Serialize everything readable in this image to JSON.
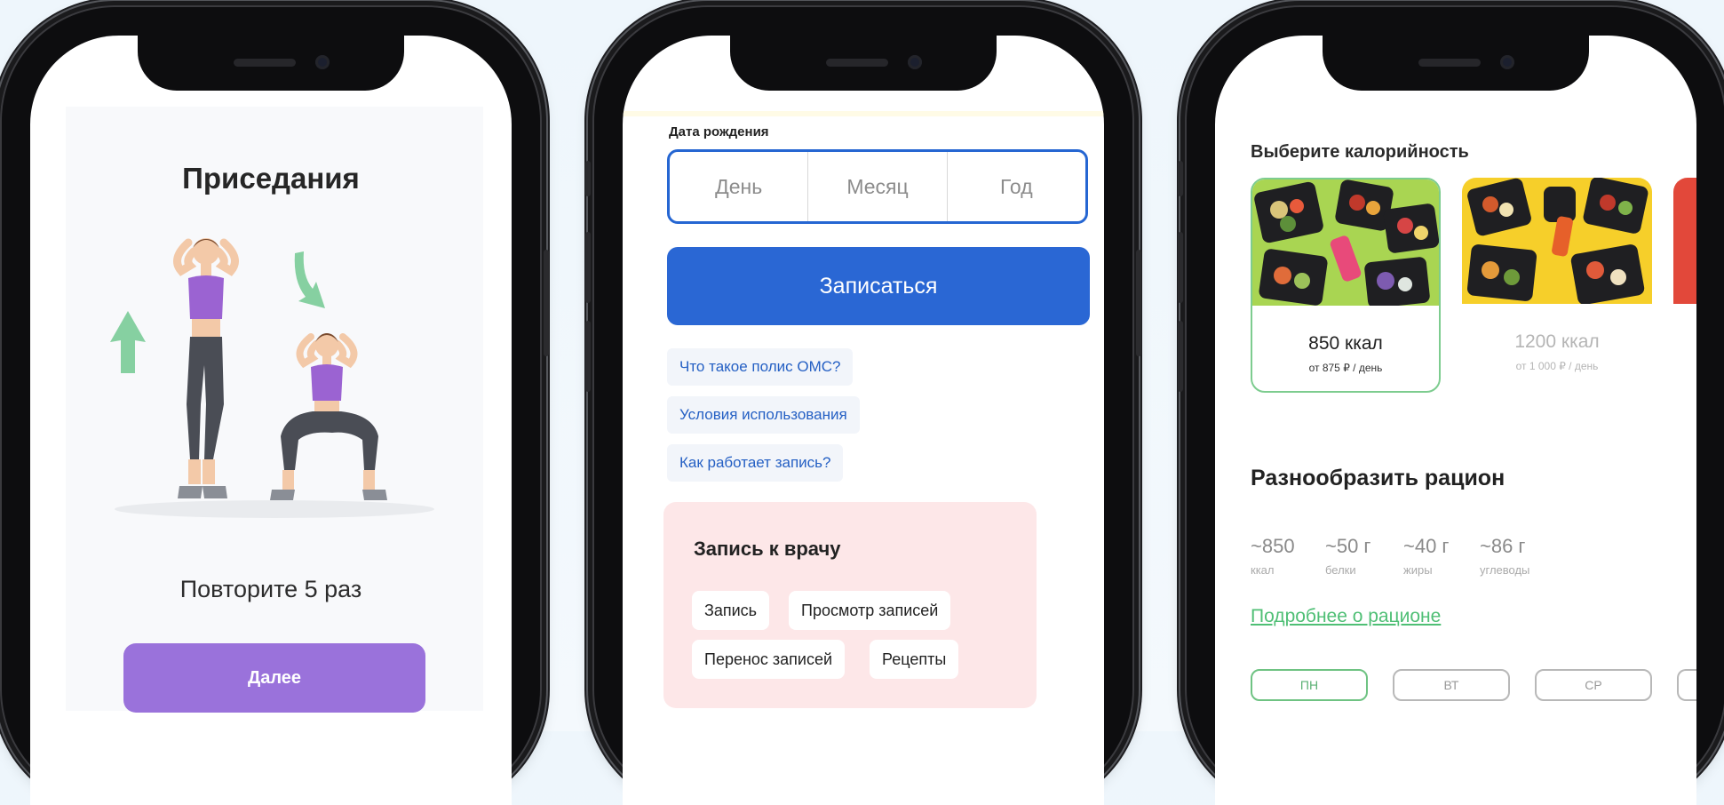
{
  "exercise": {
    "title": "Приседания",
    "repeat_text": "Повторите 5 раз",
    "next_label": "Далее"
  },
  "registration": {
    "birth_date_label": "Дата рождения",
    "date_fields": [
      "День",
      "Месяц",
      "Год"
    ],
    "submit_label": "Записаться",
    "links": [
      "Что такое полис ОМС?",
      "Условия использования",
      "Как работает запись?"
    ],
    "card": {
      "title": "Запись к врачу",
      "chips": [
        "Запись",
        "Просмотр записей",
        "Перенос записей",
        "Рецепты"
      ]
    },
    "accent_color": "#2a67d4"
  },
  "nutrition": {
    "title": "Выберите калорийность",
    "plans": [
      {
        "kcal": "850 ккал",
        "price": "от 875 ₽ / день",
        "selected": true
      },
      {
        "kcal": "1200 ккал",
        "price": "от 1 000 ₽ / день",
        "selected": false
      }
    ],
    "diversify_title": "Разнообразить рацион",
    "macros": [
      {
        "value": "~850",
        "label": "ккал"
      },
      {
        "value": "~50 г",
        "label": "белки"
      },
      {
        "value": "~40 г",
        "label": "жиры"
      },
      {
        "value": "~86 г",
        "label": "углеводы"
      }
    ],
    "more_link": "Подробнее о рационе",
    "days": [
      "ПН",
      "ВТ",
      "СР"
    ],
    "accent_color": "#4fbf75"
  }
}
